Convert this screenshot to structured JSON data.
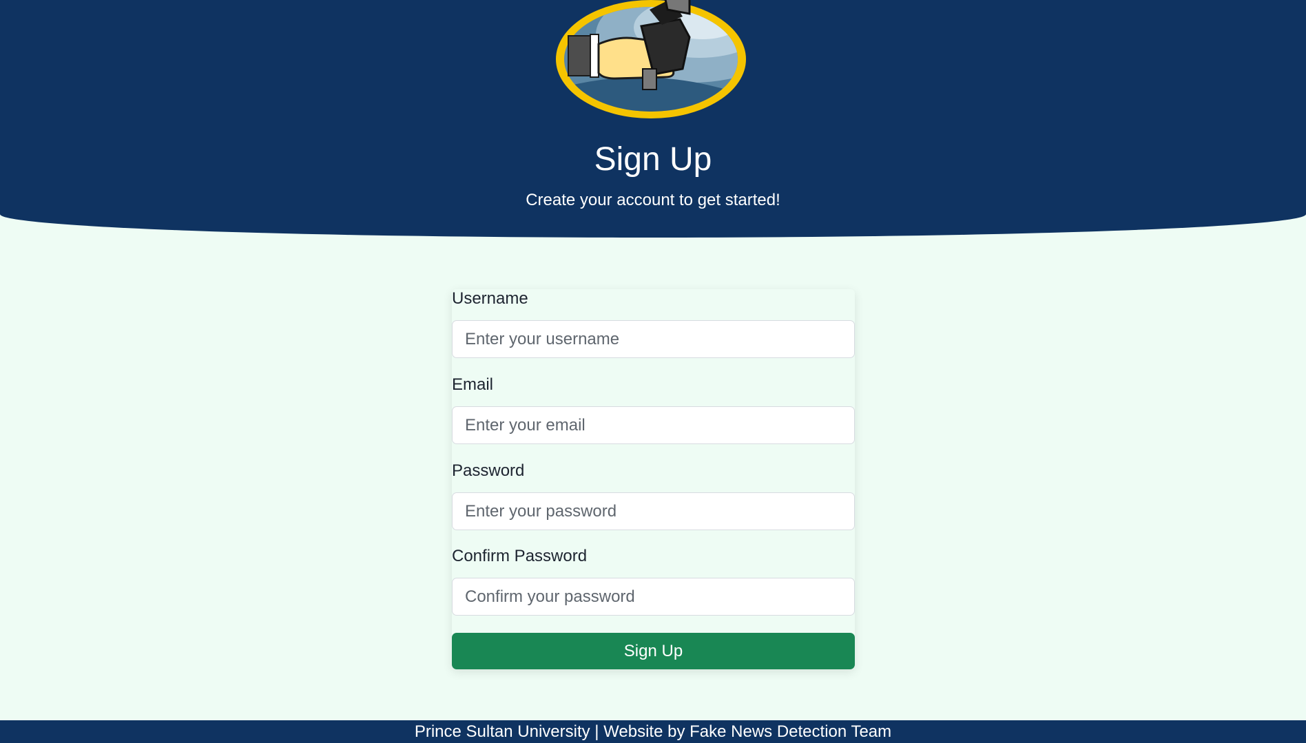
{
  "header": {
    "logo_icon": "microphone-hand-icon",
    "title": "Sign Up",
    "subtitle": "Create your account to get started!"
  },
  "form": {
    "fields": [
      {
        "label": "Username",
        "placeholder": "Enter your username",
        "value": ""
      },
      {
        "label": "Email",
        "placeholder": "Enter your email",
        "value": ""
      },
      {
        "label": "Password",
        "placeholder": "Enter your password",
        "value": ""
      },
      {
        "label": "Confirm Password",
        "placeholder": "Confirm your password",
        "value": ""
      }
    ],
    "submit_label": "Sign Up"
  },
  "footer": {
    "text": "Prince Sultan University | Website by Fake News Detection Team"
  },
  "colors": {
    "header_bg": "#0f3361",
    "page_bg": "#eefcf4",
    "button_bg": "#198754",
    "logo_ring": "#f5c400"
  }
}
